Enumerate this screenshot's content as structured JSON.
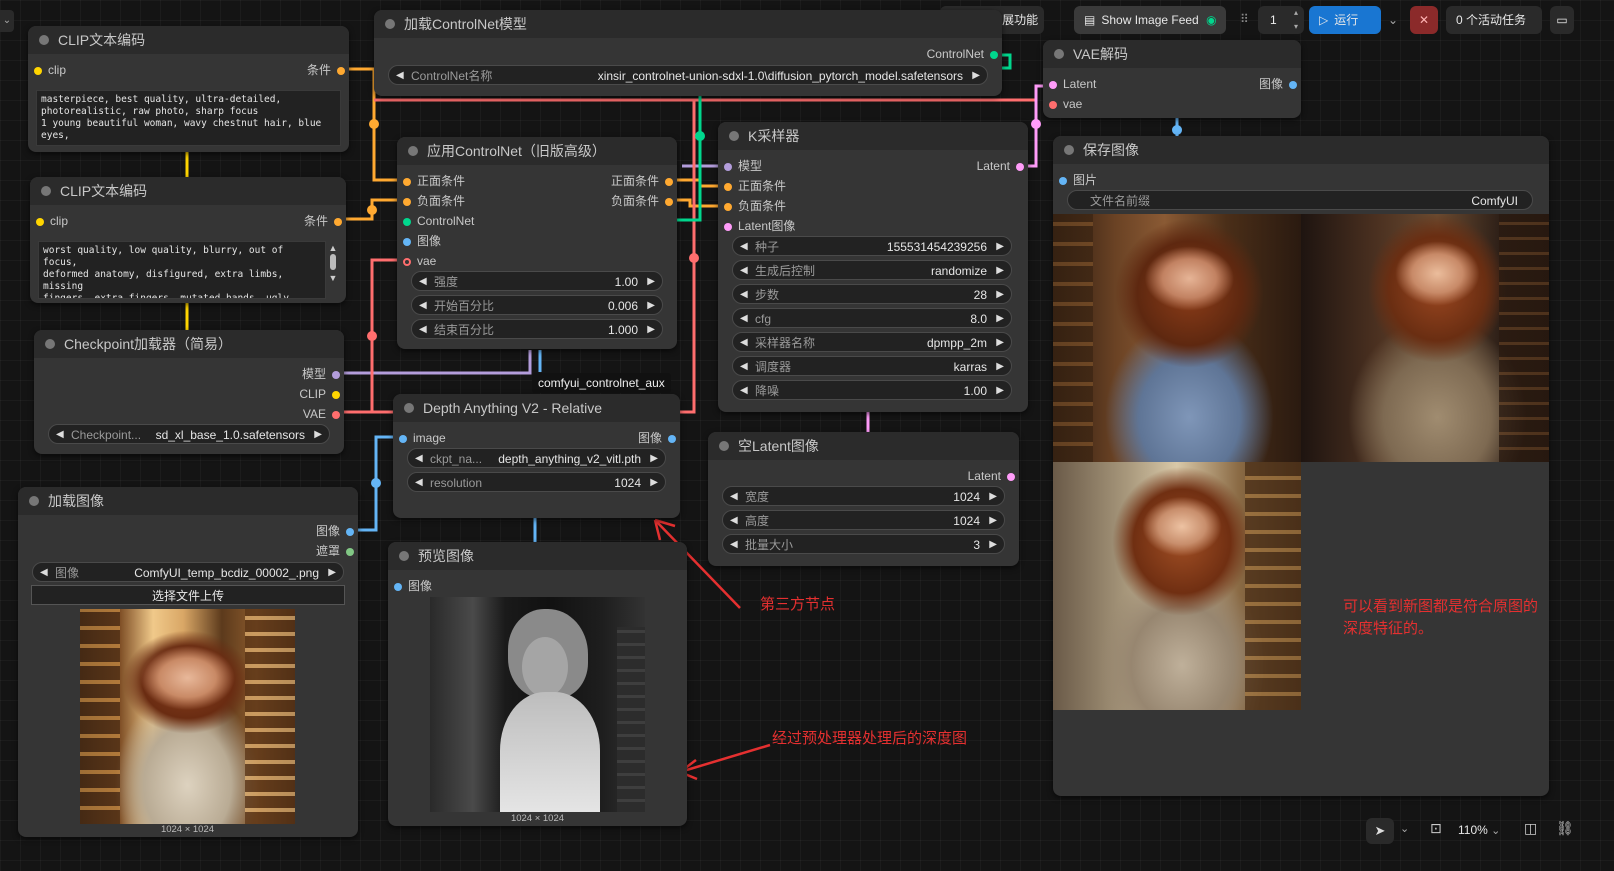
{
  "topbar": {
    "extensions_label": "管理扩展功能",
    "image_feed_label": "Show Image Feed",
    "batch_count": "1",
    "run_label": "运行",
    "active_tasks_label": "0 个活动任务"
  },
  "nodes": {
    "clip_pos": {
      "title": "CLIP文本编码",
      "in_clip": "clip",
      "out_cond": "条件",
      "text": "masterpiece, best quality, ultra-detailed,\nphotorealistic, raw photo, sharp focus\n1 young beautiful woman, wavy chestnut hair, blue\neyes,"
    },
    "clip_neg": {
      "title": "CLIP文本编码",
      "in_clip": "clip",
      "out_cond": "条件",
      "text": "worst quality, low quality, blurry, out of focus,\ndeformed anatomy, disfigured, extra limbs, missing\nfingers, extra fingers, mutated hands, ugly,\noverexposed, underexposed, watermark, text,\nsignature, cropped, jpeg artifacts, grainy"
    },
    "checkpoint": {
      "title": "Checkpoint加载器（简易）",
      "out_model": "模型",
      "out_clip": "CLIP",
      "out_vae": "VAE",
      "ckpt_label": "Checkpoint...",
      "ckpt_value": "sd_xl_base_1.0.safetensors"
    },
    "load_image": {
      "title": "加载图像",
      "out_image": "图像",
      "out_mask": "遮罩",
      "image_label": "图像",
      "image_value": "ComfyUI_temp_bcdiz_00002_.png",
      "upload_label": "选择文件上传",
      "caption": "1024 × 1024"
    },
    "load_controlnet": {
      "title": "加载ControlNet模型",
      "out_controlnet": "ControlNet",
      "name_label": "ControlNet名称",
      "name_value": "xinsir_controlnet-union-sdxl-1.0\\diffusion_pytorch_model.safetensors"
    },
    "apply_controlnet": {
      "title": "应用ControlNet（旧版高级）",
      "in_pos": "正面条件",
      "in_neg": "负面条件",
      "in_cn": "ControlNet",
      "in_image": "图像",
      "in_vae": "vae",
      "out_pos": "正面条件",
      "out_neg": "负面条件",
      "strength_label": "强度",
      "strength_value": "1.00",
      "start_label": "开始百分比",
      "start_value": "0.006",
      "end_label": "结束百分比",
      "end_value": "1.000"
    },
    "depth": {
      "title": "Depth Anything V2 - Relative",
      "badge": "comfyui_controlnet_aux",
      "in_image": "image",
      "out_image": "图像",
      "ckpt_label": "ckpt_na...",
      "ckpt_value": "depth_anything_v2_vitl.pth",
      "res_label": "resolution",
      "res_value": "1024"
    },
    "preview": {
      "title": "预览图像",
      "in_image": "图像",
      "caption": "1024 × 1024"
    },
    "ksampler": {
      "title": "K采样器",
      "in_model": "模型",
      "in_pos": "正面条件",
      "in_neg": "负面条件",
      "in_latent": "Latent图像",
      "out_latent": "Latent",
      "widgets": [
        {
          "label": "种子",
          "value": "155531454239256"
        },
        {
          "label": "生成后控制",
          "value": "randomize"
        },
        {
          "label": "步数",
          "value": "28"
        },
        {
          "label": "cfg",
          "value": "8.0"
        },
        {
          "label": "采样器名称",
          "value": "dpmpp_2m"
        },
        {
          "label": "调度器",
          "value": "karras"
        },
        {
          "label": "降噪",
          "value": "1.00"
        }
      ]
    },
    "empty_latent": {
      "title": "空Latent图像",
      "out_latent": "Latent",
      "widgets": [
        {
          "label": "宽度",
          "value": "1024"
        },
        {
          "label": "高度",
          "value": "1024"
        },
        {
          "label": "批量大小",
          "value": "3"
        }
      ]
    },
    "vae_decode": {
      "title": "VAE解码",
      "in_latent": "Latent",
      "in_vae": "vae",
      "out_image": "图像"
    },
    "save_image": {
      "title": "保存图像",
      "in_image": "图片",
      "prefix_label": "文件名前缀",
      "prefix_value": "ComfyUI"
    }
  },
  "annotations": {
    "third_party": "第三方节点",
    "depth_map": "经过预处理器处理后的深度图",
    "conclusion": "可以看到新图都是符合原图的深度特征的。"
  },
  "bottombar": {
    "zoom": "110%"
  },
  "colors": {
    "clip": "#ffd500",
    "conditioning": "#ffa931",
    "model": "#b39ddb",
    "vae": "#ff6e6e",
    "latent": "#ff9cf9",
    "image": "#64b5f6",
    "controlnet": "#00d78d",
    "mask": "#81c784",
    "run": "#1976d2"
  }
}
